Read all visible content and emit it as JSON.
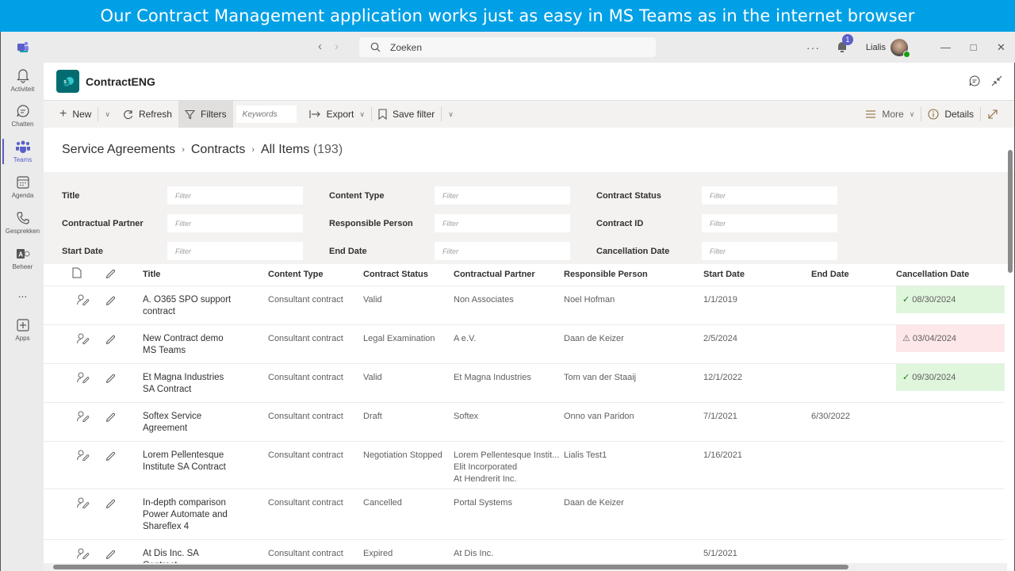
{
  "banner": {
    "text": "Our Contract Management application works just as easy in MS Teams as in the internet browser"
  },
  "titlebar": {
    "search_placeholder": "Zoeken",
    "notification_count": "1",
    "user_name": "Lialis"
  },
  "rail": {
    "items": [
      {
        "label": "Activiteit",
        "icon": "bell-icon"
      },
      {
        "label": "Chatten",
        "icon": "chat-icon"
      },
      {
        "label": "Teams",
        "icon": "teams-icon",
        "active": true
      },
      {
        "label": "Agenda",
        "icon": "calendar-icon"
      },
      {
        "label": "Gesprekken",
        "icon": "phone-icon"
      },
      {
        "label": "Beheer",
        "icon": "access-icon"
      },
      {
        "label": "...",
        "icon": "more-icon"
      },
      {
        "label": "Apps",
        "icon": "add-apps-icon"
      }
    ]
  },
  "app": {
    "title": "ContractENG"
  },
  "commandbar": {
    "new": "New",
    "refresh": "Refresh",
    "filters": "Filters",
    "keywords_placeholder": "Keywords",
    "export": "Export",
    "save_filter": "Save filter",
    "more": "More",
    "details": "Details"
  },
  "breadcrumb": {
    "items": [
      "Service Agreements",
      "Contracts",
      "All Items"
    ],
    "count": "(193)"
  },
  "filters": {
    "placeholder": "Filter",
    "fields": [
      "Title",
      "Content Type",
      "Contract Status",
      "Contractual Partner",
      "Responsible Person",
      "Contract ID",
      "Start Date",
      "End Date",
      "Cancellation Date"
    ]
  },
  "table": {
    "columns": [
      "Title",
      "Content Type",
      "Contract Status",
      "Contractual Partner",
      "Responsible Person",
      "Start Date",
      "End Date",
      "Cancellation Date"
    ],
    "rows": [
      {
        "title": "A. O365 SPO support contract",
        "content_type": "Consultant contract",
        "status": "Valid",
        "partner": "Non Associates",
        "person": "Noel Hofman",
        "start": "1/1/2019",
        "end": "",
        "cancellation": "08/30/2024",
        "cancel_state": "ok"
      },
      {
        "title": "New Contract demo MS Teams",
        "content_type": "Consultant contract",
        "status": "Legal Examination",
        "partner": "A e.V.",
        "person": "Daan de Keizer",
        "start": "2/5/2024",
        "end": "",
        "cancellation": "03/04/2024",
        "cancel_state": "warn"
      },
      {
        "title": "Et Magna Industries SA Contract",
        "content_type": "Consultant contract",
        "status": "Valid",
        "partner": "Et Magna Industries",
        "person": "Tom van der Staaij",
        "start": "12/1/2022",
        "end": "",
        "cancellation": "09/30/2024",
        "cancel_state": "ok"
      },
      {
        "title": "Softex Service Agreement",
        "content_type": "Consultant contract",
        "status": "Draft",
        "partner": "Softex",
        "person": "Onno van Paridon",
        "start": "7/1/2021",
        "end": "6/30/2022",
        "cancellation": "",
        "cancel_state": ""
      },
      {
        "title": "Lorem Pellentesque Institute SA Contract",
        "content_type": "Consultant contract",
        "status": "Negotiation Stopped",
        "partner": "Lorem Pellentesque Instit...\nElit Incorporated\nAt Hendrerit Inc.",
        "person": "Lialis Test1",
        "start": "1/16/2021",
        "end": "",
        "cancellation": "",
        "cancel_state": ""
      },
      {
        "title": "In-depth comparison Power Automate and Shareflex 4",
        "content_type": "Consultant contract",
        "status": "Cancelled",
        "partner": "Portal Systems",
        "person": "Daan de Keizer",
        "start": "",
        "end": "",
        "cancellation": "",
        "cancel_state": ""
      },
      {
        "title": "At Dis Inc. SA Contract",
        "content_type": "Consultant contract",
        "status": "Expired",
        "partner": "At Dis Inc.",
        "person": "",
        "start": "5/1/2021",
        "end": "",
        "cancellation": "",
        "cancel_state": ""
      }
    ]
  },
  "colors": {
    "teams_accent": "#5b5fc7",
    "banner": "#00a0e6",
    "sharepoint_teal": "#036c70",
    "cancel_ok_bg": "#dff6dd",
    "cancel_warn_bg": "#fde7e9"
  }
}
